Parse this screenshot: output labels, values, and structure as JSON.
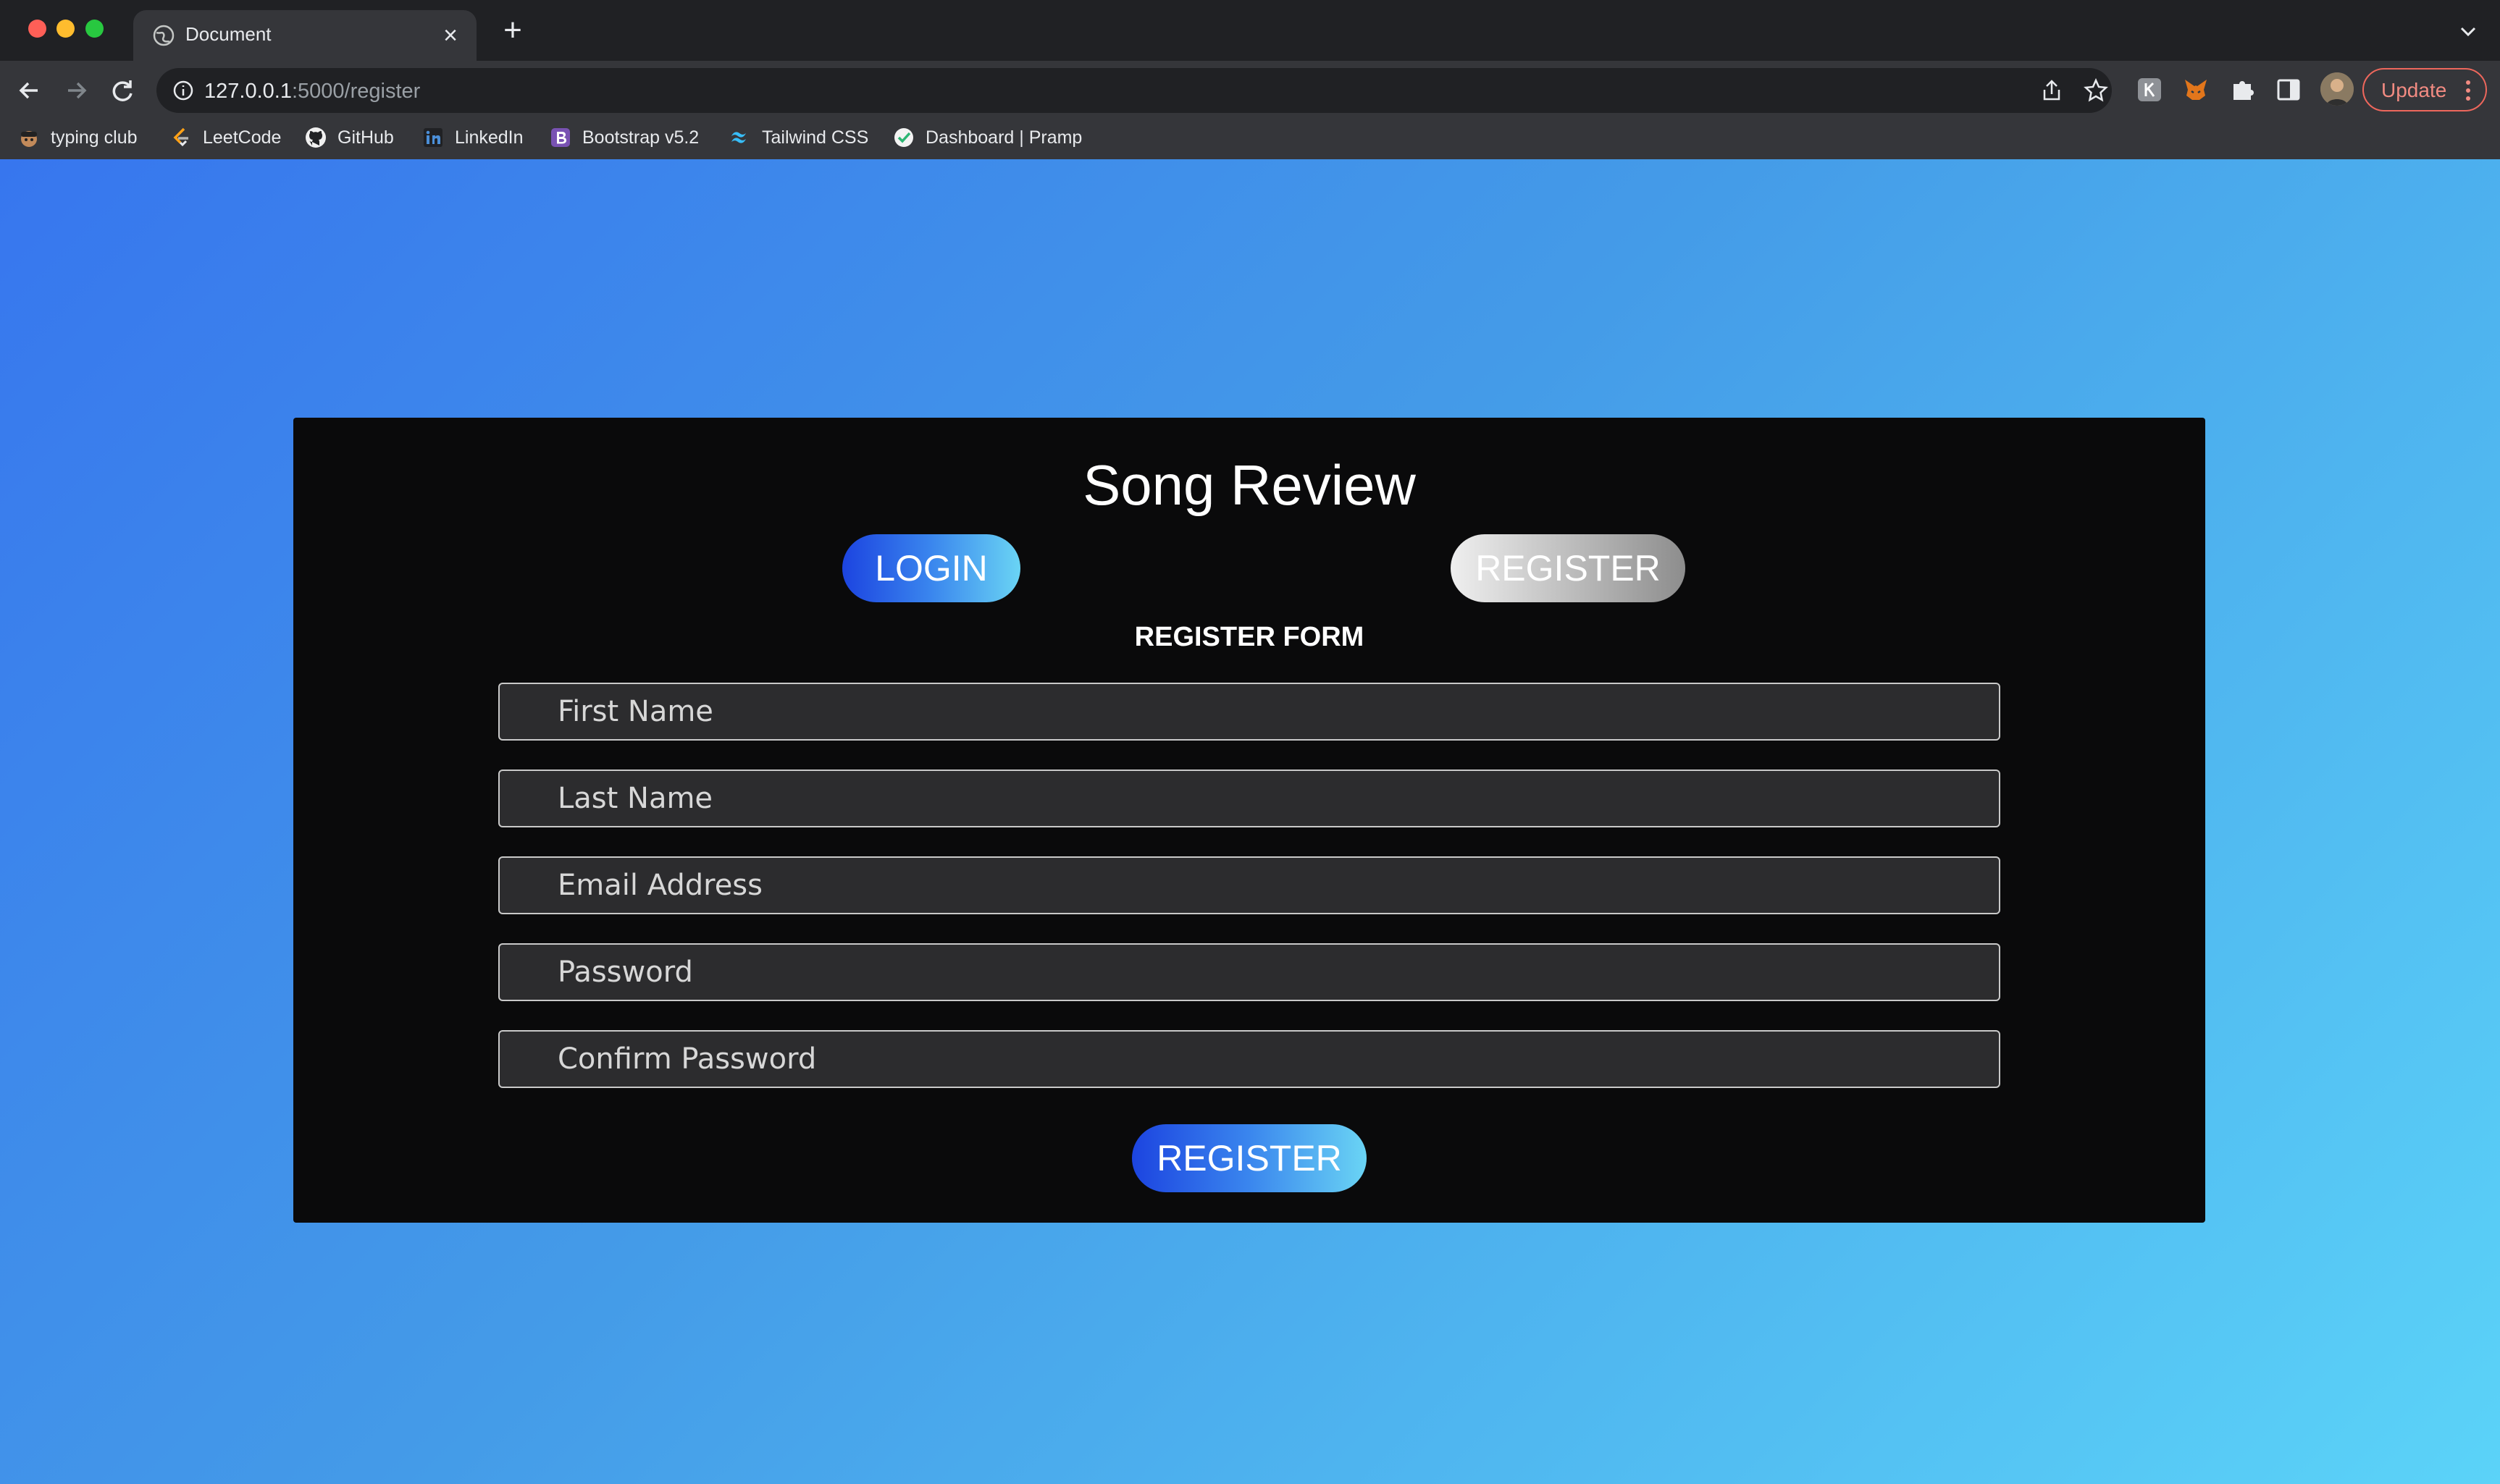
{
  "browser": {
    "tab_title": "Document",
    "url_host": "127.0.0.1",
    "url_path": ":5000/register",
    "update_label": "Update",
    "bookmarks": [
      {
        "label": "typing club",
        "icon": "typing-club-icon"
      },
      {
        "label": "LeetCode",
        "icon": "leetcode-icon"
      },
      {
        "label": "GitHub",
        "icon": "github-icon"
      },
      {
        "label": "LinkedIn",
        "icon": "linkedin-icon"
      },
      {
        "label": "Bootstrap v5.2",
        "icon": "bootstrap-icon"
      },
      {
        "label": "Tailwind CSS",
        "icon": "tailwind-icon"
      },
      {
        "label": "Dashboard | Pramp",
        "icon": "pramp-icon"
      }
    ]
  },
  "page": {
    "title": "Song Review",
    "login_label": "LOGIN",
    "register_tab_label": "REGISTER",
    "form_title": "REGISTER FORM",
    "fields": {
      "first_name": "First Name",
      "last_name": "Last Name",
      "email": "Email Address",
      "password": "Password",
      "confirm_password": "Confirm Password"
    },
    "submit_label": "REGISTER"
  },
  "colors": {
    "page_gradient_start": "#3776ee",
    "page_gradient_end": "#5bd3f8",
    "card_bg": "#0a0a0b",
    "active_button_gradient": [
      "#1c44e0",
      "#6ad4f4"
    ],
    "inactive_button_gradient": [
      "#efefef",
      "#8d8d8d"
    ],
    "field_bg": "#2c2c2e"
  }
}
